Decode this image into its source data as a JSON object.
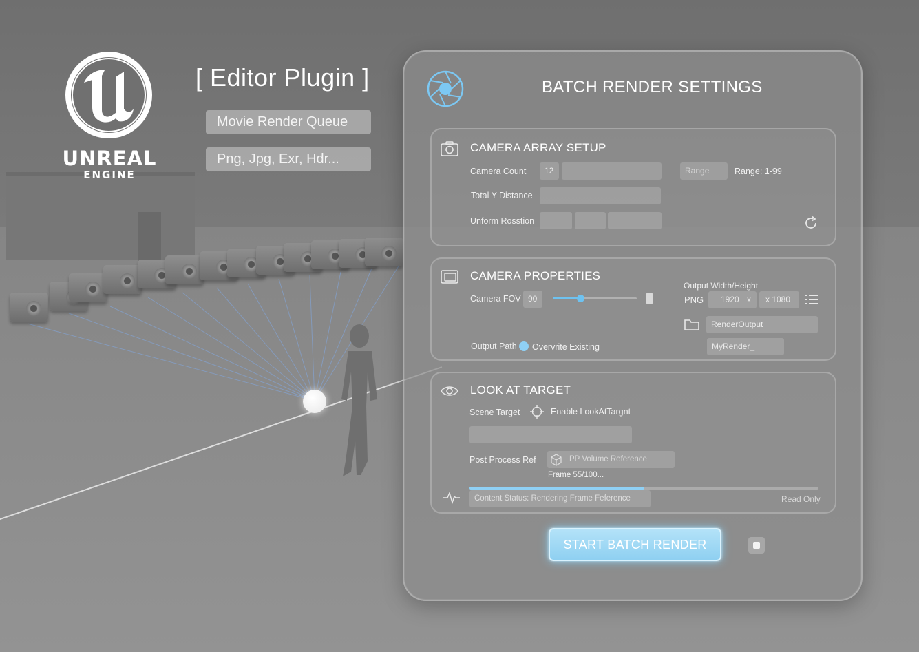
{
  "brand": {
    "logo_icon": "unreal-logo-icon",
    "wordmark": "UNREAL",
    "wordmark_sub": "ENGINE",
    "plugin_title": "[ Editor Plugin ]",
    "tag_1": "Movie Render Queue",
    "tag_2": "Png, Jpg, Exr, Hdr..."
  },
  "panel": {
    "title": "BATCH RENDER SETTINGS",
    "icon": "aperture-icon"
  },
  "camera_array": {
    "title": "CAMERA ARRAY SETUP",
    "icon": "camera-icon",
    "camera_count_label": "Camera Count",
    "camera_count_value": "12",
    "range_field": "Range",
    "range_text": "Range: 1-99",
    "total_y_distance_label": "Total Y-Distance",
    "uniform_rotation_label": "Unform Rosstion",
    "reset_icon": "refresh-icon"
  },
  "camera_props": {
    "title": "CAMERA PROPERTIES",
    "icon": "frame-icon",
    "fov_label": "Camera FOV",
    "fov_value": "90",
    "fov_slider_fraction": 0.33,
    "output_wh_label": "Output Width/Height",
    "format": "PNG",
    "width": "1920",
    "width_suffix": "x",
    "height": "x 1080",
    "list_icon": "list-icon",
    "folder_icon": "folder-icon",
    "output_folder": "RenderOutput",
    "output_path_label": "Output Path",
    "overwrite_label": "Overvrite Existing",
    "file_prefix": "MyRender_"
  },
  "look_at": {
    "title": "LOOK AT TARGET",
    "icon": "eye-icon",
    "scene_target_label": "Scene Target",
    "enable_label": "Enable LookAtTargnt",
    "crosshair_icon": "crosshair-icon",
    "post_process_label": "Post Process Ref",
    "cube_icon": "cube-icon",
    "pp_volume": "PP Volume Reference",
    "frame_text": "Frame 55/100...",
    "progress_fraction": 0.5,
    "pulse_icon": "pulse-icon",
    "status_text": "Content Status: Rendering Frame Feference",
    "read_only": "Read Only"
  },
  "actions": {
    "start_label": "START BATCH RENDER",
    "stop_icon": "stop-icon"
  },
  "colors": {
    "accent": "#8fd0f5",
    "accent_strong": "#6ec2f0"
  }
}
